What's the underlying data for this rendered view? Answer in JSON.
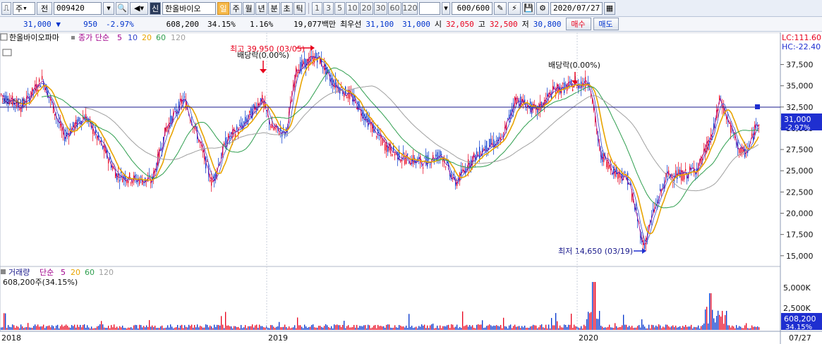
{
  "toolbar": {
    "market": "주",
    "market_label": "전",
    "code": "009420",
    "stock_name": "한올바이오",
    "period_buttons": [
      "일",
      "주",
      "월",
      "년",
      "분",
      "초",
      "틱"
    ],
    "selected_period": "일",
    "intervals": [
      "1",
      "3",
      "5",
      "10",
      "20",
      "30",
      "60",
      "120"
    ],
    "count_value": "600",
    "count_total": "/600",
    "date": "2020/07/27"
  },
  "quote": {
    "price": "31,000",
    "arrow": "▼",
    "change": "950",
    "change_pct": "-2.97%",
    "volume": "608,200",
    "volume_ratio": "34.15%",
    "turnover": "1.16%",
    "amount": "19,077백만",
    "best_label": "최우선",
    "best_ask": "31,100",
    "best_bid": "31,000",
    "open_label": "시",
    "open": "32,050",
    "high_label": "고",
    "high": "32,500",
    "low_label": "저",
    "low": "30,800",
    "buy": "매수",
    "sell": "매도"
  },
  "price_panel": {
    "name": "한올바이오파마",
    "indicator": "종가 단순",
    "ma": [
      "5",
      "10",
      "20",
      "60",
      "120"
    ],
    "lc": "LC:111.60",
    "hc": "HC:-22.40",
    "level_label": "32,505",
    "current_price": "31,000",
    "current_pct": "-2.97%",
    "annotations": {
      "high": "최고 39,950 (03/05)",
      "low": "최저 14,650 (03/19)",
      "dividend1": "배당락(0.00%)",
      "dividend2": "배당락(0.00%)"
    },
    "y_ticks": [
      "37,500",
      "35,000",
      "32,500",
      "30,000",
      "27,500",
      "25,000",
      "22,500",
      "20,000",
      "17,500",
      "15,000"
    ]
  },
  "volume_panel": {
    "name": "거래량",
    "indicator": "단순",
    "ma": [
      "5",
      "20",
      "60",
      "120"
    ],
    "value_label": "608,200주(34.15%)",
    "y_ticks": [
      "5,000K",
      "2,500K"
    ],
    "current": "608,200",
    "current_pct": "34.15%"
  },
  "x_axis": {
    "labels": [
      "2018",
      "2019",
      "2020"
    ],
    "date_label": "07/27"
  },
  "colors": {
    "up": "#e8001c",
    "down": "#0033cc",
    "ma5": "#a0008c",
    "ma10": "#3344cc",
    "ma20": "#e8a400",
    "ma60": "#2e9e4e",
    "ma120": "#a0a0a0"
  }
}
